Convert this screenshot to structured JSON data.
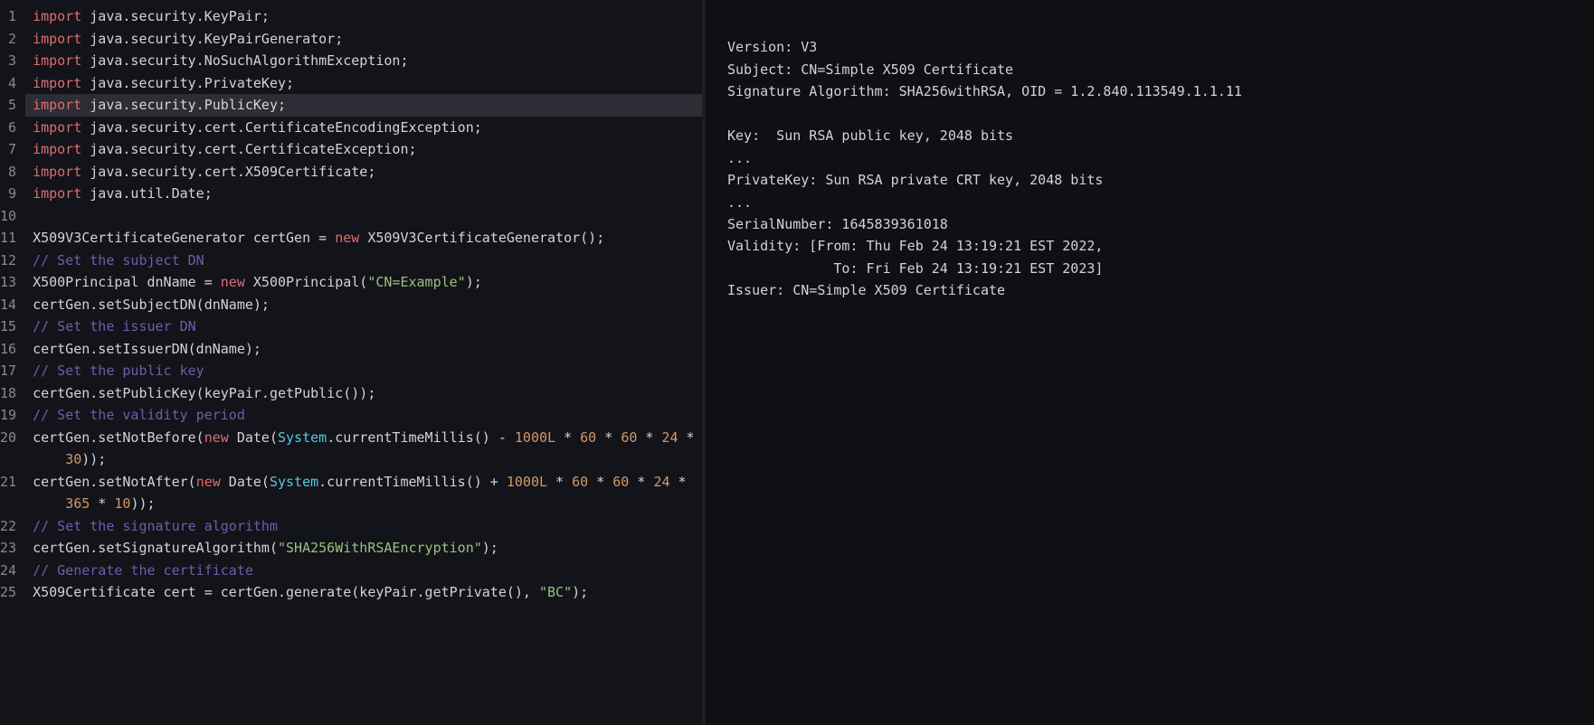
{
  "editor": {
    "highlighted_line": 5,
    "lines": [
      [
        [
          "kw",
          "import"
        ],
        [
          "id",
          " java.security.KeyPair;"
        ]
      ],
      [
        [
          "kw",
          "import"
        ],
        [
          "id",
          " java.security.KeyPairGenerator;"
        ]
      ],
      [
        [
          "kw",
          "import"
        ],
        [
          "id",
          " java.security.NoSuchAlgorithmException;"
        ]
      ],
      [
        [
          "kw",
          "import"
        ],
        [
          "id",
          " java.security.PrivateKey;"
        ]
      ],
      [
        [
          "kw",
          "import"
        ],
        [
          "id",
          " java.security.PublicKey;"
        ]
      ],
      [
        [
          "kw",
          "import"
        ],
        [
          "id",
          " java.security.cert.CertificateEncodingException;"
        ]
      ],
      [
        [
          "kw",
          "import"
        ],
        [
          "id",
          " java.security.cert.CertificateException;"
        ]
      ],
      [
        [
          "kw",
          "import"
        ],
        [
          "id",
          " java.security.cert.X509Certificate;"
        ]
      ],
      [
        [
          "kw",
          "import"
        ],
        [
          "id",
          " java.util.Date;"
        ]
      ],
      [],
      [
        [
          "id",
          "X509V3CertificateGenerator certGen = "
        ],
        [
          "kw",
          "new"
        ],
        [
          "id",
          " X509V3CertificateGenerator();"
        ]
      ],
      [
        [
          "cmt",
          "// Set the subject DN"
        ]
      ],
      [
        [
          "id",
          "X500Principal dnName = "
        ],
        [
          "kw",
          "new"
        ],
        [
          "id",
          " X500Principal("
        ],
        [
          "str",
          "\"CN=Example\""
        ],
        [
          "id",
          ");"
        ]
      ],
      [
        [
          "id",
          "certGen.setSubjectDN(dnName);"
        ]
      ],
      [
        [
          "cmt",
          "// Set the issuer DN"
        ]
      ],
      [
        [
          "id",
          "certGen.setIssuerDN(dnName);"
        ]
      ],
      [
        [
          "cmt",
          "// Set the public key"
        ]
      ],
      [
        [
          "id",
          "certGen.setPublicKey(keyPair.getPublic());"
        ]
      ],
      [
        [
          "cmt",
          "// Set the validity period"
        ]
      ],
      [
        [
          "id",
          "certGen.setNotBefore("
        ],
        [
          "kw",
          "new"
        ],
        [
          "id",
          " Date("
        ],
        [
          "sys",
          "System"
        ],
        [
          "id",
          ".currentTimeMillis() - "
        ],
        [
          "num",
          "1000L"
        ],
        [
          "id",
          " * "
        ],
        [
          "num",
          "60"
        ],
        [
          "id",
          " * "
        ],
        [
          "num",
          "60"
        ],
        [
          "id",
          " * "
        ],
        [
          "num",
          "24"
        ],
        [
          "id",
          " * "
        ]
      ],
      [
        [
          "id",
          "    "
        ],
        [
          "num",
          "30"
        ],
        [
          "id",
          "));"
        ]
      ],
      [
        [
          "id",
          "certGen.setNotAfter("
        ],
        [
          "kw",
          "new"
        ],
        [
          "id",
          " Date("
        ],
        [
          "sys",
          "System"
        ],
        [
          "id",
          ".currentTimeMillis() + "
        ],
        [
          "num",
          "1000L"
        ],
        [
          "id",
          " * "
        ],
        [
          "num",
          "60"
        ],
        [
          "id",
          " * "
        ],
        [
          "num",
          "60"
        ],
        [
          "id",
          " * "
        ],
        [
          "num",
          "24"
        ],
        [
          "id",
          " * "
        ]
      ],
      [
        [
          "id",
          "    "
        ],
        [
          "num",
          "365"
        ],
        [
          "id",
          " * "
        ],
        [
          "num",
          "10"
        ],
        [
          "id",
          "));"
        ]
      ],
      [
        [
          "cmt",
          "// Set the signature algorithm"
        ]
      ],
      [
        [
          "id",
          "certGen.setSignatureAlgorithm("
        ],
        [
          "str",
          "\"SHA256WithRSAEncryption\""
        ],
        [
          "id",
          ");"
        ]
      ],
      [
        [
          "cmt",
          "// Generate the certificate"
        ]
      ],
      [
        [
          "id",
          "X509Certificate cert = certGen.generate(keyPair.getPrivate(), "
        ],
        [
          "str",
          "\"BC\""
        ],
        [
          "id",
          ");"
        ]
      ]
    ],
    "wrapped": {
      "20": true,
      "22": true
    },
    "display_line_numbers": [
      1,
      2,
      3,
      4,
      5,
      6,
      7,
      8,
      9,
      10,
      11,
      12,
      13,
      14,
      15,
      16,
      17,
      18,
      19,
      20,
      "",
      21,
      "",
      22,
      23,
      24,
      25
    ]
  },
  "output": {
    "lines": [
      "",
      "Version: V3",
      "Subject: CN=Simple X509 Certificate",
      "Signature Algorithm: SHA256withRSA, OID = 1.2.840.113549.1.1.11",
      "",
      "Key:  Sun RSA public key, 2048 bits",
      "...",
      "PrivateKey: Sun RSA private CRT key, 2048 bits",
      "...",
      "SerialNumber: 1645839361018",
      "Validity: [From: Thu Feb 24 13:19:21 EST 2022,",
      "             To: Fri Feb 24 13:19:21 EST 2023]",
      "Issuer: CN=Simple X509 Certificate"
    ]
  }
}
